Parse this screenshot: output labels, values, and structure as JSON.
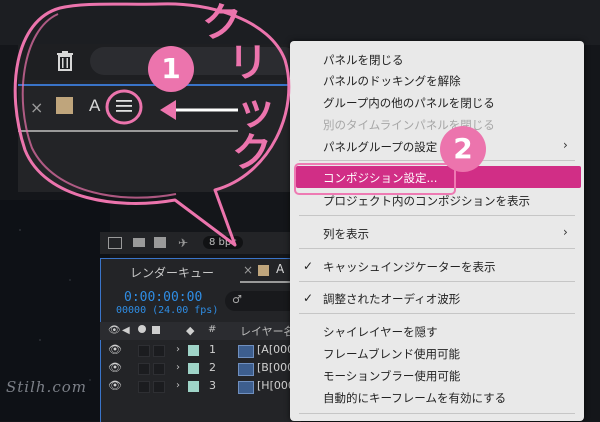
{
  "bubble_panel": {
    "tab_close": "×",
    "tab_label": "A"
  },
  "comp_panel": {
    "bpc": "8 bpc",
    "render_queue_tab": "レンダーキュー",
    "tab_close": "×",
    "tab_label": "A",
    "timecode": "0:00:00:00",
    "fps": "00000 (24.00 fps)",
    "search_icon": "♂",
    "col_hash": "#",
    "col_name": "レイヤー名",
    "layers": [
      {
        "num": "1",
        "name": "[A[000"
      },
      {
        "num": "2",
        "name": "[B[000"
      },
      {
        "num": "3",
        "name": "[H[000"
      }
    ]
  },
  "context_menu": {
    "items": [
      {
        "label": "パネルを閉じる"
      },
      {
        "label": "パネルのドッキングを解除"
      },
      {
        "label": "グループ内の他のパネルを閉じる"
      },
      {
        "label": "別のタイムラインパネルを閉じる",
        "disabled": true
      },
      {
        "label": "パネルグループの設定",
        "submenu": true
      },
      {
        "label": "コンポジション設定...",
        "highlighted": true
      },
      {
        "label": "プロジェクト内のコンポジションを表示"
      },
      {
        "label": "列を表示",
        "submenu": true
      },
      {
        "label": "キャッシュインジケーターを表示",
        "checked": true
      },
      {
        "label": "調整されたオーディオ波形",
        "checked": true
      },
      {
        "label": "シャイレイヤーを隠す"
      },
      {
        "label": "フレームブレンド使用可能"
      },
      {
        "label": "モーションブラー使用可能"
      },
      {
        "label": "自動的にキーフレームを有効にする"
      }
    ],
    "submenu_arrow": "›",
    "check_mark": "✓",
    "highlight_color": "#d12e86"
  },
  "annotations": {
    "step1": "1",
    "step2": "2",
    "click_text": [
      "ク",
      "リ",
      "ッ",
      "ク"
    ],
    "accent_color": "#ec74ad"
  },
  "background": {
    "handwriting": "Stilh.com"
  }
}
